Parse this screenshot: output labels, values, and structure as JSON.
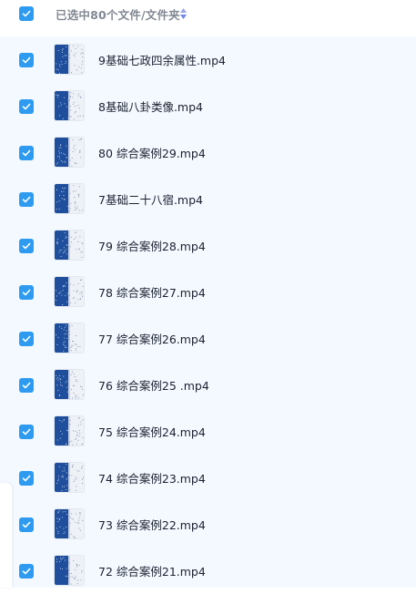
{
  "header": {
    "selection_text": "已选中80个文件/文件夹",
    "select_all_checked": true,
    "sort_icon": "sort-updown-icon"
  },
  "colors": {
    "accent": "#2e9bf0",
    "list_background": "#f3f9ff",
    "thumb_blue": "#1f4f9c"
  },
  "files": [
    {
      "name": "9基础七政四余属性.mp4",
      "checked": true,
      "thumb_icon": "video-thumbnail-icon"
    },
    {
      "name": "8基础八卦类像.mp4",
      "checked": true,
      "thumb_icon": "video-thumbnail-icon"
    },
    {
      "name": "80 综合案例29.mp4",
      "checked": true,
      "thumb_icon": "video-thumbnail-icon"
    },
    {
      "name": "7基础二十八宿.mp4",
      "checked": true,
      "thumb_icon": "video-thumbnail-icon"
    },
    {
      "name": "79 综合案例28.mp4",
      "checked": true,
      "thumb_icon": "video-thumbnail-icon"
    },
    {
      "name": "78 综合案例27.mp4",
      "checked": true,
      "thumb_icon": "video-thumbnail-icon"
    },
    {
      "name": "77 综合案例26.mp4",
      "checked": true,
      "thumb_icon": "video-thumbnail-icon"
    },
    {
      "name": "76 综合案例25 .mp4",
      "checked": true,
      "thumb_icon": "video-thumbnail-icon"
    },
    {
      "name": "75 综合案例24.mp4",
      "checked": true,
      "thumb_icon": "video-thumbnail-icon"
    },
    {
      "name": "74 综合案例23.mp4",
      "checked": true,
      "thumb_icon": "video-thumbnail-icon"
    },
    {
      "name": "73 综合案例22.mp4",
      "checked": true,
      "thumb_icon": "video-thumbnail-icon"
    },
    {
      "name": "72 综合案例21.mp4",
      "checked": true,
      "thumb_icon": "video-thumbnail-icon"
    }
  ]
}
